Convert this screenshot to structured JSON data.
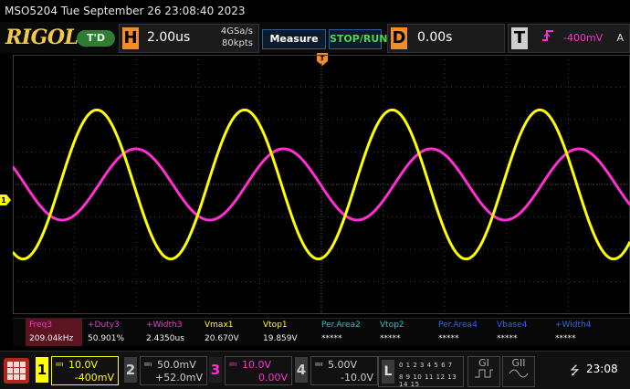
{
  "titlebar": {
    "text": "MSO5204  Tue September 26 23:08:40 2023"
  },
  "toolbar": {
    "logo": "RIGOL",
    "trigger_state": "T'D",
    "horizontal": {
      "letter": "H",
      "timebase": "2.00us",
      "sample_rate": "4GSa/s",
      "memory_depth": "80kpts"
    },
    "measure_label": "Measure",
    "stoprun_label": "STOP/RUN",
    "delay": {
      "letter": "D",
      "value": "0.00s"
    },
    "trigger": {
      "letter": "T",
      "edge": "rising-edge-icon",
      "level": "-400mV",
      "mode": "A"
    }
  },
  "measurements": [
    {
      "label": "Freq3",
      "value": "209.04kHz",
      "color": "#ff2fd0",
      "active": true
    },
    {
      "label": "+Duty3",
      "value": "50.901%",
      "color": "#ff2fd0"
    },
    {
      "label": "+Width3",
      "value": "2.4350us",
      "color": "#ff2fd0"
    },
    {
      "label": "Vmax1",
      "value": "20.670V",
      "color": "#ffff00"
    },
    {
      "label": "Vtop1",
      "value": "19.859V",
      "color": "#ffff00"
    },
    {
      "label": "Per.Area2",
      "value": "*****",
      "color": "#18c8c8"
    },
    {
      "label": "Vtop2",
      "value": "*****",
      "color": "#18c8c8"
    },
    {
      "label": "Per.Area4",
      "value": "*****",
      "color": "#3060ff"
    },
    {
      "label": "Vbase4",
      "value": "*****",
      "color": "#3060ff"
    },
    {
      "label": "+Width4",
      "value": "*****",
      "color": "#3060ff"
    }
  ],
  "channels": [
    {
      "num": "1",
      "scale": "10.0V",
      "offset": "-400mV"
    },
    {
      "num": "2",
      "scale": "50.0mV",
      "offset": "+52.0mV"
    },
    {
      "num": "3",
      "scale": "10.0V",
      "offset": "0.00V"
    },
    {
      "num": "4",
      "scale": "5.00V",
      "offset": "-10.0V"
    }
  ],
  "la": {
    "letter": "L",
    "row1": "0 1 2 3 4 5 6 7",
    "row2": "8 9 10 11 12 13 14 15"
  },
  "generators": {
    "g1": "GI",
    "g2": "GII"
  },
  "status": {
    "usb_icon": "usb-icon",
    "clock": "23:08"
  },
  "colors": {
    "ch1": "#ffff00",
    "ch3": "#ff2fd0",
    "ch2": "#18c8c8",
    "ch4": "#3060ff",
    "accent": "#f28c28"
  },
  "waveforms": {
    "ch1": {
      "amplitude_div": 2.3,
      "periods_per_screen": 4.18,
      "phase_deg": 245
    },
    "ch3": {
      "amplitude_div": 1.1,
      "periods_per_screen": 4.18,
      "phase_deg": 150
    }
  }
}
